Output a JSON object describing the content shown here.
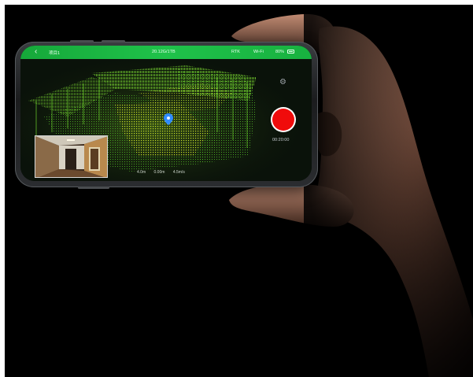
{
  "statusbar": {
    "back_icon": "chevron-left-icon",
    "project_name": "项目1",
    "storage": "20.12G/1TB",
    "rtk": "RTK",
    "wifi": "Wi-Fi",
    "battery": "80%"
  },
  "controls": {
    "settings_icon": "gear-icon",
    "record_color": "#f00b0b",
    "timer": "00:20:00"
  },
  "readouts": {
    "value_1": "4.0m",
    "value_2": "0.00m",
    "value_3": "4.5m/s"
  },
  "colors": {
    "statusbar": "#1fc24a",
    "pointcloud_primary": "#5ccf2a",
    "pointcloud_highlight": "#d6e82a",
    "location_pin": "#2f8cff"
  }
}
